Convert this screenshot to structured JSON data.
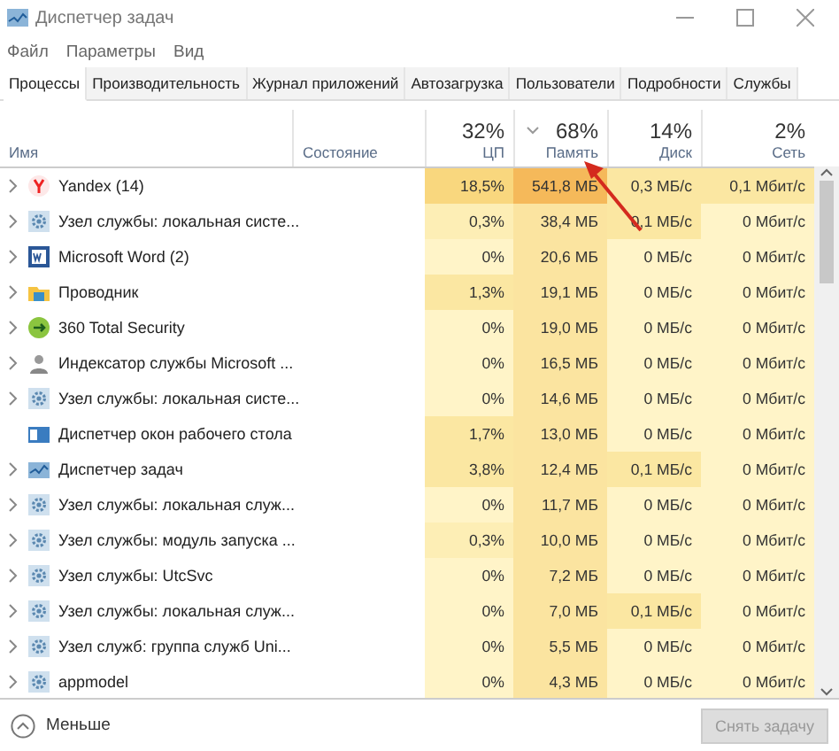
{
  "window": {
    "title": "Диспетчер задач"
  },
  "menu": [
    "Файл",
    "Параметры",
    "Вид"
  ],
  "tabs": [
    {
      "label": "Процессы",
      "selected": true
    },
    {
      "label": "Производительность",
      "selected": false
    },
    {
      "label": "Журнал приложений",
      "selected": false
    },
    {
      "label": "Автозагрузка",
      "selected": false
    },
    {
      "label": "Пользователи",
      "selected": false
    },
    {
      "label": "Подробности",
      "selected": false
    },
    {
      "label": "Службы",
      "selected": false
    }
  ],
  "table": {
    "columns": [
      {
        "label": "Имя",
        "sorted": false
      },
      {
        "label": "Состояние",
        "sorted": false
      },
      {
        "total": "32%",
        "label": "ЦП",
        "sorted": false
      },
      {
        "total": "68%",
        "label": "Память",
        "sorted": true
      },
      {
        "total": "14%",
        "label": "Диск",
        "sorted": false
      },
      {
        "total": "2%",
        "label": "Сеть",
        "sorted": false
      }
    ],
    "rows": [
      {
        "kind": "yandex",
        "expandable": true,
        "cells": [
          {
            "text": "Yandex (14)"
          },
          {
            "text": ""
          },
          {
            "text": "18,5%",
            "color": "#f9d77e"
          },
          {
            "text": "541,8 МБ",
            "color": "#f5b95a"
          },
          {
            "text": "0,3 МБ/с",
            "color": "#fbe7a2"
          },
          {
            "text": "0,1 Мбит/с",
            "color": "#fbe7a2"
          }
        ]
      },
      {
        "kind": "gear",
        "expandable": true,
        "cells": [
          {
            "text": "Узел службы: локальная систе..."
          },
          {
            "text": ""
          },
          {
            "text": "0,3%",
            "color": "#fdeeb5"
          },
          {
            "text": "38,4 МБ",
            "color": "#fbe4a0"
          },
          {
            "text": "0,1 МБ/с",
            "color": "#fbe7a2"
          },
          {
            "text": "0 Мбит/с",
            "color": "#fff4c8"
          }
        ]
      },
      {
        "kind": "word",
        "expandable": true,
        "cells": [
          {
            "text": "Microsoft Word (2)"
          },
          {
            "text": ""
          },
          {
            "text": "0%",
            "color": "#fff4c8"
          },
          {
            "text": "20,6 МБ",
            "color": "#fbe4a0"
          },
          {
            "text": "0 МБ/с",
            "color": "#fff4c8"
          },
          {
            "text": "0 Мбит/с",
            "color": "#fff4c8"
          }
        ]
      },
      {
        "kind": "folder",
        "expandable": true,
        "cells": [
          {
            "text": "Проводник"
          },
          {
            "text": ""
          },
          {
            "text": "1,3%",
            "color": "#fbe7a2"
          },
          {
            "text": "19,1 МБ",
            "color": "#fbe4a0"
          },
          {
            "text": "0 МБ/с",
            "color": "#fff4c8"
          },
          {
            "text": "0 Мбит/с",
            "color": "#fff4c8"
          }
        ]
      },
      {
        "kind": "shield",
        "expandable": true,
        "cells": [
          {
            "text": "360 Total Security"
          },
          {
            "text": ""
          },
          {
            "text": "0%",
            "color": "#fff4c8"
          },
          {
            "text": "19,0 МБ",
            "color": "#fbe4a0"
          },
          {
            "text": "0 МБ/с",
            "color": "#fff4c8"
          },
          {
            "text": "0 Мбит/с",
            "color": "#fff4c8"
          }
        ]
      },
      {
        "kind": "indexer",
        "expandable": true,
        "cells": [
          {
            "text": "Индексатор службы Microsoft ..."
          },
          {
            "text": ""
          },
          {
            "text": "0%",
            "color": "#fff4c8"
          },
          {
            "text": "16,5 МБ",
            "color": "#fbe4a0"
          },
          {
            "text": "0 МБ/с",
            "color": "#fff4c8"
          },
          {
            "text": "0 Мбит/с",
            "color": "#fff4c8"
          }
        ]
      },
      {
        "kind": "gear",
        "expandable": true,
        "cells": [
          {
            "text": "Узел службы: локальная систе..."
          },
          {
            "text": ""
          },
          {
            "text": "0%",
            "color": "#fff4c8"
          },
          {
            "text": "14,6 МБ",
            "color": "#fbe4a0"
          },
          {
            "text": "0 МБ/с",
            "color": "#fff4c8"
          },
          {
            "text": "0 Мбит/с",
            "color": "#fff4c8"
          }
        ]
      },
      {
        "kind": "window",
        "expandable": false,
        "cells": [
          {
            "text": "Диспетчер окон рабочего стола"
          },
          {
            "text": ""
          },
          {
            "text": "1,7%",
            "color": "#fbe7a2"
          },
          {
            "text": "13,0 МБ",
            "color": "#fbe4a0"
          },
          {
            "text": "0 МБ/с",
            "color": "#fff4c8"
          },
          {
            "text": "0 Мбит/с",
            "color": "#fff4c8"
          }
        ]
      },
      {
        "kind": "taskmgr",
        "expandable": true,
        "cells": [
          {
            "text": "Диспетчер задач"
          },
          {
            "text": ""
          },
          {
            "text": "3,8%",
            "color": "#fbe7a2"
          },
          {
            "text": "12,4 МБ",
            "color": "#fbe4a0"
          },
          {
            "text": "0,1 МБ/с",
            "color": "#fbe7a2"
          },
          {
            "text": "0 Мбит/с",
            "color": "#fff4c8"
          }
        ]
      },
      {
        "kind": "gear",
        "expandable": true,
        "cells": [
          {
            "text": "Узел службы: локальная служ..."
          },
          {
            "text": ""
          },
          {
            "text": "0%",
            "color": "#fff4c8"
          },
          {
            "text": "11,7 МБ",
            "color": "#fbe4a0"
          },
          {
            "text": "0 МБ/с",
            "color": "#fff4c8"
          },
          {
            "text": "0 Мбит/с",
            "color": "#fff4c8"
          }
        ]
      },
      {
        "kind": "gear",
        "expandable": true,
        "cells": [
          {
            "text": "Узел службы: модуль запуска ..."
          },
          {
            "text": ""
          },
          {
            "text": "0,3%",
            "color": "#fdeeb5"
          },
          {
            "text": "10,0 МБ",
            "color": "#fbe4a0"
          },
          {
            "text": "0 МБ/с",
            "color": "#fff4c8"
          },
          {
            "text": "0 Мбит/с",
            "color": "#fff4c8"
          }
        ]
      },
      {
        "kind": "gear",
        "expandable": true,
        "cells": [
          {
            "text": "Узел службы: UtcSvc"
          },
          {
            "text": ""
          },
          {
            "text": "0%",
            "color": "#fff4c8"
          },
          {
            "text": "7,2 МБ",
            "color": "#fbe4a0"
          },
          {
            "text": "0 МБ/с",
            "color": "#fff4c8"
          },
          {
            "text": "0 Мбит/с",
            "color": "#fff4c8"
          }
        ]
      },
      {
        "kind": "gear",
        "expandable": true,
        "cells": [
          {
            "text": "Узел службы: локальная служ..."
          },
          {
            "text": ""
          },
          {
            "text": "0%",
            "color": "#fff4c8"
          },
          {
            "text": "7,0 МБ",
            "color": "#fbe4a0"
          },
          {
            "text": "0,1 МБ/с",
            "color": "#fbe7a2"
          },
          {
            "text": "0 Мбит/с",
            "color": "#fff4c8"
          }
        ]
      },
      {
        "kind": "gear",
        "expandable": true,
        "cells": [
          {
            "text": "Узел служб: группа служб Uni..."
          },
          {
            "text": ""
          },
          {
            "text": "0%",
            "color": "#fff4c8"
          },
          {
            "text": "5,5 МБ",
            "color": "#fbe4a0"
          },
          {
            "text": "0 МБ/с",
            "color": "#fff4c8"
          },
          {
            "text": "0 Мбит/с",
            "color": "#fff4c8"
          }
        ]
      },
      {
        "kind": "gear",
        "expandable": true,
        "cells": [
          {
            "text": "appmodel"
          },
          {
            "text": ""
          },
          {
            "text": "0%",
            "color": "#fff4c8"
          },
          {
            "text": "4,3 МБ",
            "color": "#fbe4a0"
          },
          {
            "text": "0 МБ/с",
            "color": "#fff4c8"
          },
          {
            "text": "0 Мбит/с",
            "color": "#fff4c8"
          }
        ]
      }
    ]
  },
  "footer": {
    "toggle": "Меньше",
    "end_task": {
      "label": "Снять задачу",
      "disabled": true
    }
  }
}
